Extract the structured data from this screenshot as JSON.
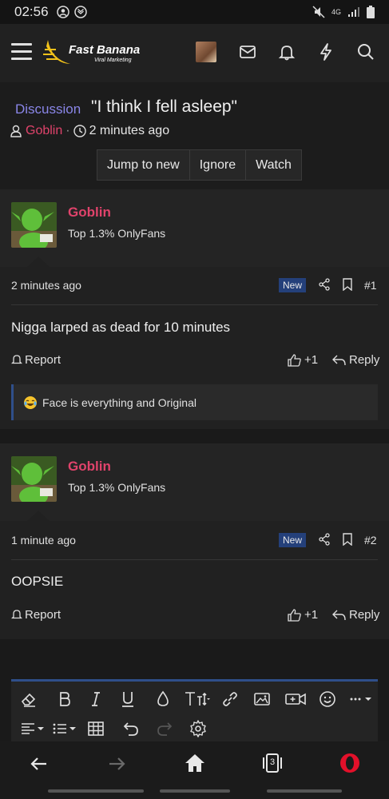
{
  "status": {
    "time": "02:56",
    "network": "4G"
  },
  "header": {
    "brand": "Fast Banana",
    "tagline": "Viral Marketing"
  },
  "thread": {
    "prefix": "Discussion",
    "title": "\"I think I fell asleep\"",
    "author": "Goblin",
    "separator": "·",
    "age": "2 minutes ago",
    "buttons": [
      "Jump to new",
      "Ignore",
      "Watch"
    ]
  },
  "posts": [
    {
      "user": "Goblin",
      "rank": "Top 1.3% OnlyFans",
      "date": "2 minutes ago",
      "badge": "New",
      "number": "#1",
      "message": "Nigga larped as dead for 10 minutes",
      "report": "Report",
      "likes": "+1",
      "reply": "Reply",
      "reaction_text": "Face is everything and Original"
    },
    {
      "user": "Goblin",
      "rank": "Top 1.3% OnlyFans",
      "date": "1 minute ago",
      "badge": "New",
      "number": "#2",
      "message": "OOPSIE",
      "report": "Report",
      "likes": "+1",
      "reply": "Reply"
    }
  ],
  "browser": {
    "tab_count": "3"
  },
  "colors": {
    "accent_username": "#e0436b",
    "prefix": "#8a86e8",
    "new_badge": "#24407a",
    "editor_border": "#2f4f8a"
  }
}
